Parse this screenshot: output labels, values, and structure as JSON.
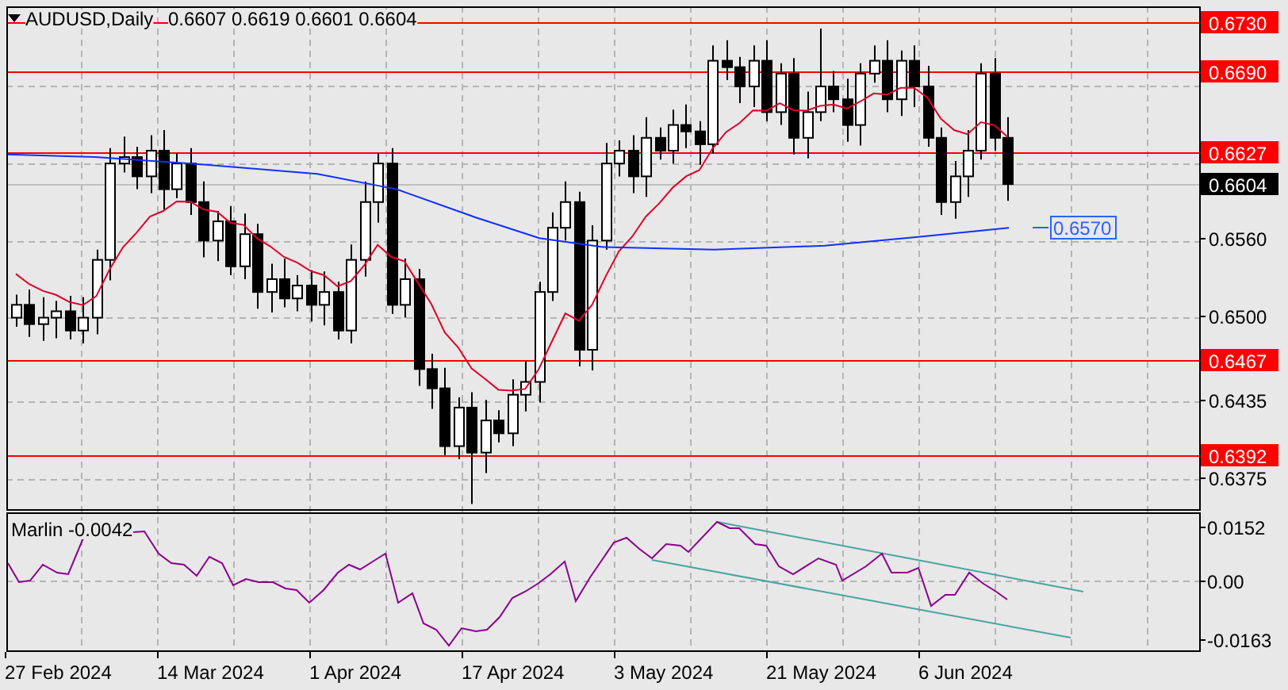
{
  "chart": {
    "symbol": "AUDUSD,Daily",
    "ohlc": "0.6607 0.6619 0.6601 0.6604",
    "price_axis": [
      {
        "label": "0.6730",
        "kind": "level"
      },
      {
        "label": "0.6690",
        "kind": "level"
      },
      {
        "label": "0.6627",
        "kind": "level"
      },
      {
        "label": "0.6604",
        "kind": "current"
      },
      {
        "label": "0.6560",
        "kind": "plain"
      },
      {
        "label": "0.6500",
        "kind": "plain"
      },
      {
        "label": "0.6467",
        "kind": "level"
      },
      {
        "label": "0.6435",
        "kind": "plain"
      },
      {
        "label": "0.6392",
        "kind": "level"
      },
      {
        "label": "0.6375",
        "kind": "plain"
      }
    ],
    "ma_label": "0.6570",
    "indicator": {
      "label": "Marlin -0.0042",
      "axis": [
        "0.0152",
        "0.00",
        "-0.0163"
      ]
    },
    "dates": [
      "27 Feb 2024",
      "14 Mar 2024",
      "1 Apr 2024",
      "17 Apr 2024",
      "3 May 2024",
      "21 May 2024",
      "6 Jun 2024"
    ]
  }
}
